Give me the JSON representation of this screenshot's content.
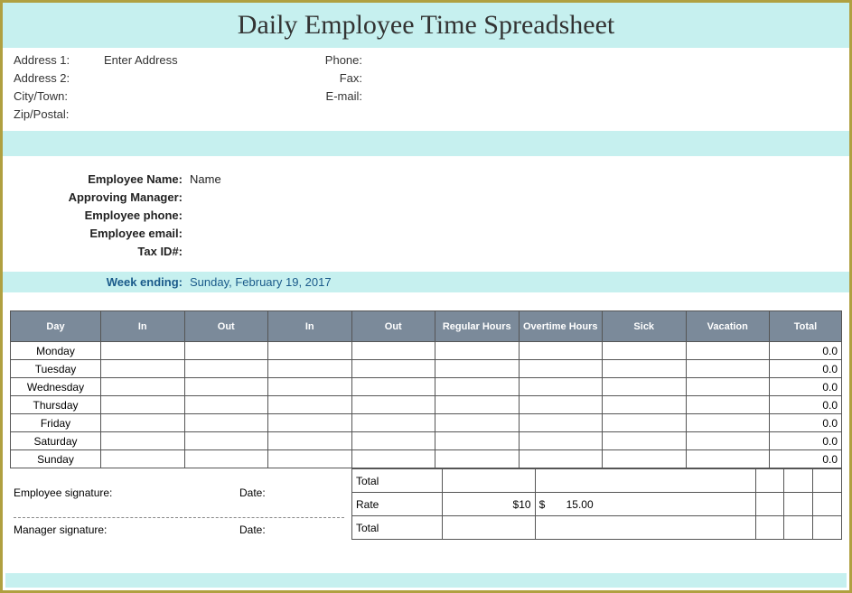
{
  "title": "Daily Employee Time Spreadsheet",
  "contact": {
    "address1_label": "Address 1:",
    "address1_value": "Enter Address",
    "address2_label": "Address 2:",
    "address2_value": "",
    "city_label": "City/Town:",
    "city_value": "",
    "zip_label": "Zip/Postal:",
    "zip_value": "",
    "phone_label": "Phone:",
    "phone_value": "",
    "fax_label": "Fax:",
    "fax_value": "",
    "email_label": "E-mail:",
    "email_value": ""
  },
  "employee": {
    "name_label": "Employee Name:",
    "name_value": "Name",
    "manager_label": "Approving Manager:",
    "manager_value": "",
    "phone_label": "Employee phone:",
    "phone_value": "",
    "email_label": "Employee email:",
    "email_value": "",
    "taxid_label": "Tax ID#:",
    "taxid_value": ""
  },
  "week": {
    "label": "Week ending:",
    "value": "Sunday, February 19, 2017"
  },
  "columns": {
    "day": "Day",
    "in1": "In",
    "out1": "Out",
    "in2": "In",
    "out2": "Out",
    "regular": "Regular Hours",
    "overtime": "Overtime Hours",
    "sick": "Sick",
    "vacation": "Vacation",
    "total": "Total"
  },
  "rows": [
    {
      "day": "Monday",
      "total": "0.0"
    },
    {
      "day": "Tuesday",
      "total": "0.0"
    },
    {
      "day": "Wednesday",
      "total": "0.0"
    },
    {
      "day": "Thursday",
      "total": "0.0"
    },
    {
      "day": "Friday",
      "total": "0.0"
    },
    {
      "day": "Saturday",
      "total": "0.0"
    },
    {
      "day": "Sunday",
      "total": "0.0"
    }
  ],
  "summary": {
    "total_label": "Total",
    "rate_label": "Rate",
    "rate_reg": "$10",
    "rate_ot_prefix": "$",
    "rate_ot": "15.00",
    "total2_label": "Total"
  },
  "signatures": {
    "employee_label": "Employee signature:",
    "manager_label": "Manager signature:",
    "date_label": "Date:"
  }
}
